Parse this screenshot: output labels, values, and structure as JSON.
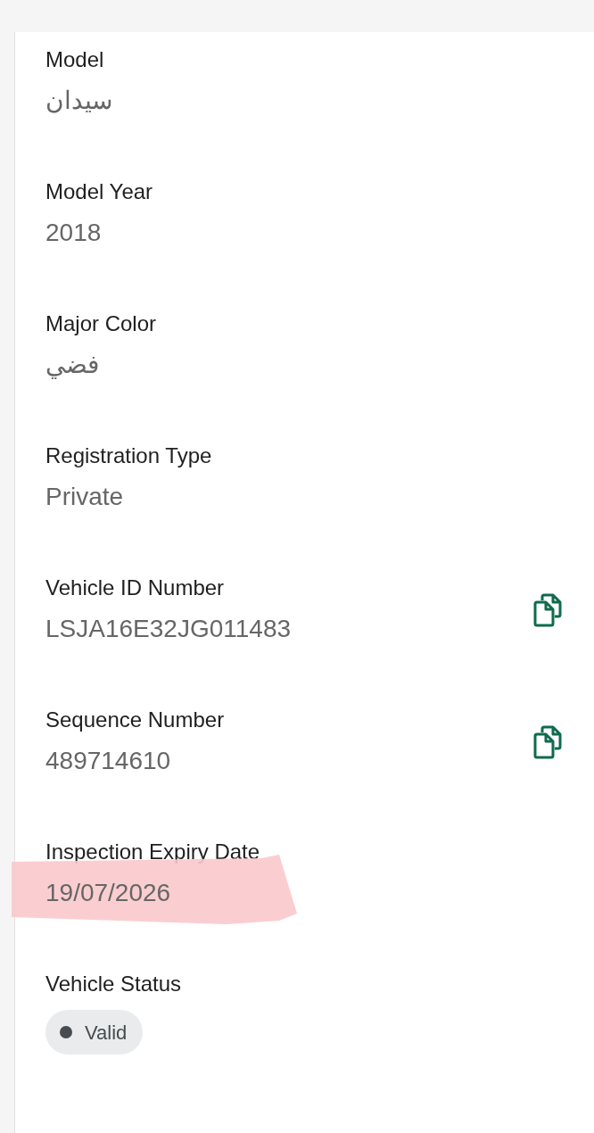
{
  "fields": [
    {
      "kind": "text",
      "label": "Model",
      "value": "سيدان"
    },
    {
      "kind": "text",
      "label": "Model Year",
      "value": "2018"
    },
    {
      "kind": "text",
      "label": "Major Color",
      "value": "فضي"
    },
    {
      "kind": "text",
      "label": "Registration Type",
      "value": "Private"
    },
    {
      "kind": "copy",
      "label": "Vehicle ID Number",
      "value": "LSJA16E32JG011483"
    },
    {
      "kind": "copy",
      "label": "Sequence Number",
      "value": "489714610"
    },
    {
      "kind": "marked",
      "label": "Inspection Expiry Date",
      "value": "19/07/2026"
    },
    {
      "kind": "status",
      "label": "Vehicle Status",
      "value": "Valid",
      "color": "#474c50"
    }
  ]
}
